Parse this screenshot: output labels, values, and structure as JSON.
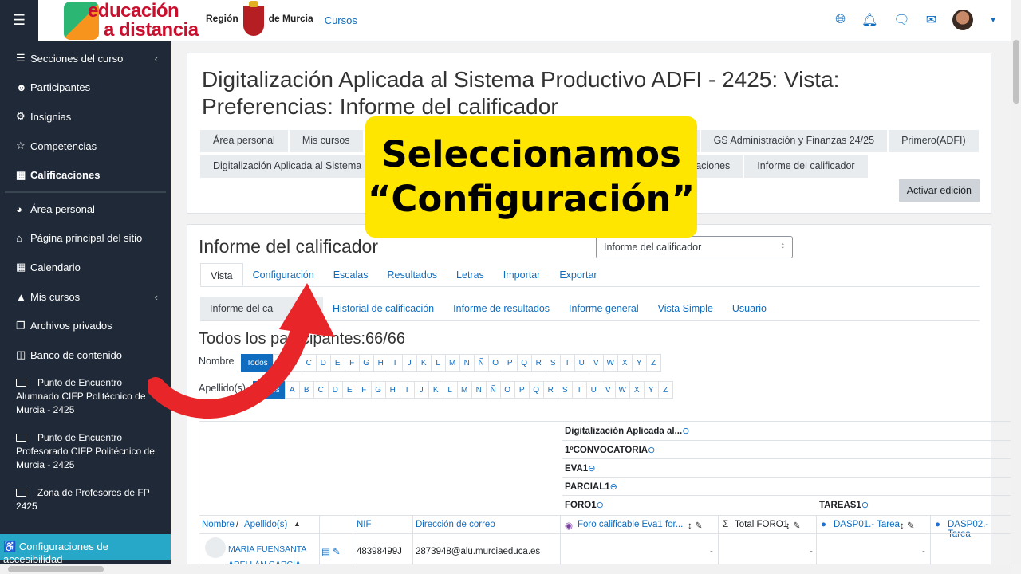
{
  "topbar": {
    "logo_line1": "educación",
    "logo_line2": "a distancia",
    "region_line": "Región",
    "region_line2": "de Murcia",
    "cursos": "Cursos",
    "icons": [
      "globe-icon",
      "bell-icon",
      "chat-icon",
      "mail-icon"
    ]
  },
  "sidebar": {
    "items": [
      {
        "label": "Secciones del curso",
        "icon": "list-icon",
        "chevron": "‹"
      },
      {
        "label": "Participantes",
        "icon": "user-icon"
      },
      {
        "label": "Insignias",
        "icon": "badge-icon"
      },
      {
        "label": "Competencias",
        "icon": "star-icon"
      },
      {
        "label": "Calificaciones",
        "icon": "table-icon"
      },
      {
        "label": "Área personal",
        "icon": "dashboard-icon"
      },
      {
        "label": "Página principal del sitio",
        "icon": "home-icon"
      },
      {
        "label": "Calendario",
        "icon": "calendar-icon"
      },
      {
        "label": "Mis cursos",
        "icon": "graduation-icon",
        "chevron": "‹"
      },
      {
        "label": "Archivos privados",
        "icon": "files-icon"
      },
      {
        "label": "Banco de contenido",
        "icon": "clipboard-icon"
      }
    ],
    "groups": [
      "Punto de Encuentro Alumnado CIFP Politécnico de Murcia - 2425",
      "Punto de Encuentro Profesorado CIFP Politécnico de Murcia - 2425",
      "Zona de Profesores de FP 2425"
    ],
    "access": "Configuraciones de accesibilidad"
  },
  "page": {
    "title": "Digitalización Aplicada al Sistema Productivo ADFI - 2425: Vista: Preferencias: Informe del calificador",
    "breadcrumb1": [
      "Área personal",
      "Mis cursos",
      "",
      "GS Administración y Finanzas 24/25",
      "Primero(ADFI)"
    ],
    "breadcrumb2": [
      "Digitalización Aplicada al Sistema",
      "",
      "aciones",
      "Informe del calificador"
    ],
    "edit_button": "Activar edición"
  },
  "report": {
    "heading": "Informe del calificador",
    "select_value": "Informe del calificador",
    "tabs": [
      "Vista",
      "Configuración",
      "Escalas",
      "Resultados",
      "Letras",
      "Importar",
      "Exportar"
    ],
    "subtabs": [
      "Informe del ca",
      "Historial de calificación",
      "Informe de resultados",
      "Informe general",
      "Vista Simple",
      "Usuario"
    ],
    "participants": "Todos los participantes:66/66",
    "name_label": "Nombre",
    "surname_label": "Apellido(s)",
    "todos": "Todos",
    "letters": [
      "A",
      "B",
      "C",
      "D",
      "E",
      "F",
      "G",
      "H",
      "I",
      "J",
      "K",
      "L",
      "M",
      "N",
      "Ñ",
      "O",
      "P",
      "Q",
      "R",
      "S",
      "T",
      "U",
      "V",
      "W",
      "X",
      "Y",
      "Z"
    ],
    "cat_rows": [
      "Digitalización Aplicada al...",
      "1ºCONVOCATORIA",
      "EVA1",
      "PARCIAL1",
      "FORO1"
    ],
    "tareas": "TAREAS1",
    "headers": {
      "name": "Nombre",
      "sep": "/",
      "surname": "Apellido(s)",
      "nif": "NIF",
      "email": "Dirección de correo",
      "col1": "Foro calificable Eva1 for...",
      "col2": "Total FORO1",
      "col3": "DASP01.- Tarea",
      "col4": "DASP02.- Tarea"
    },
    "row": {
      "name": "MARÍA FUENSANTA",
      "name2": "ARELLÁN GARCÍA",
      "nif": "48398499J",
      "email": "2873948@alu.murciaeduca.es",
      "v1": "-",
      "v2": "-",
      "v3": "-"
    }
  },
  "overlay": {
    "line1": "Seleccionamos",
    "line2": "“Configuración”"
  },
  "colors": {
    "sidebar": "#1f2937",
    "link": "#0f6cbf",
    "overlay": "#ffe600",
    "arrow": "#e8262a"
  }
}
